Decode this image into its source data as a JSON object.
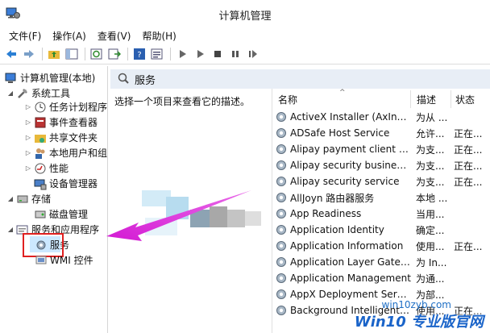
{
  "window": {
    "title": "计算机管理"
  },
  "menu": {
    "items": [
      "文件(F)",
      "操作(A)",
      "查看(V)",
      "帮助(H)"
    ]
  },
  "tree": {
    "root": "计算机管理(本地)",
    "system_tools": "系统工具",
    "task_scheduler": "任务计划程序",
    "event_viewer": "事件查看器",
    "shared_folders": "共享文件夹",
    "local_users": "本地用户和组",
    "performance": "性能",
    "device_manager": "设备管理器",
    "storage": "存储",
    "disk_management": "磁盘管理",
    "services_apps": "服务和应用程序",
    "services": "服务",
    "wmi": "WMI 控件"
  },
  "pane": {
    "header": "服务",
    "description_hint": "选择一个项目来查看它的描述。"
  },
  "columns": {
    "name": "名称",
    "description": "描述",
    "status": "状态"
  },
  "services": [
    {
      "name": "ActiveX Installer (AxInstSV)",
      "desc": "为从 ...",
      "status": ""
    },
    {
      "name": "ADSafe Host Service",
      "desc": "允许...",
      "status": "正在..."
    },
    {
      "name": "Alipay payment client sec...",
      "desc": "为支...",
      "status": "正在..."
    },
    {
      "name": "Alipay security business s...",
      "desc": "为支...",
      "status": "正在..."
    },
    {
      "name": "Alipay security service",
      "desc": "为支...",
      "status": "正在..."
    },
    {
      "name": "AllJoyn 路由器服务",
      "desc": "本地 ...",
      "status": ""
    },
    {
      "name": "App Readiness",
      "desc": "当用...",
      "status": ""
    },
    {
      "name": "Application Identity",
      "desc": "确定...",
      "status": ""
    },
    {
      "name": "Application Information",
      "desc": "使用...",
      "status": "正在..."
    },
    {
      "name": "Application Layer Gatewa...",
      "desc": "为 In...",
      "status": ""
    },
    {
      "name": "Application Management",
      "desc": "为通...",
      "status": ""
    },
    {
      "name": "AppX Deployment Servic...",
      "desc": "为部...",
      "status": ""
    },
    {
      "name": "Background Intelligent T...",
      "desc": "使用...",
      "status": "正在..."
    }
  ],
  "watermark": {
    "url": "win10zyb.com",
    "text": "Win10 专业版官网"
  },
  "colors": {
    "highlight_box": "#e02020",
    "annotation_arrow": "#d81bd8",
    "selection": "#cce8ff",
    "watermark": "#1a64c9"
  }
}
